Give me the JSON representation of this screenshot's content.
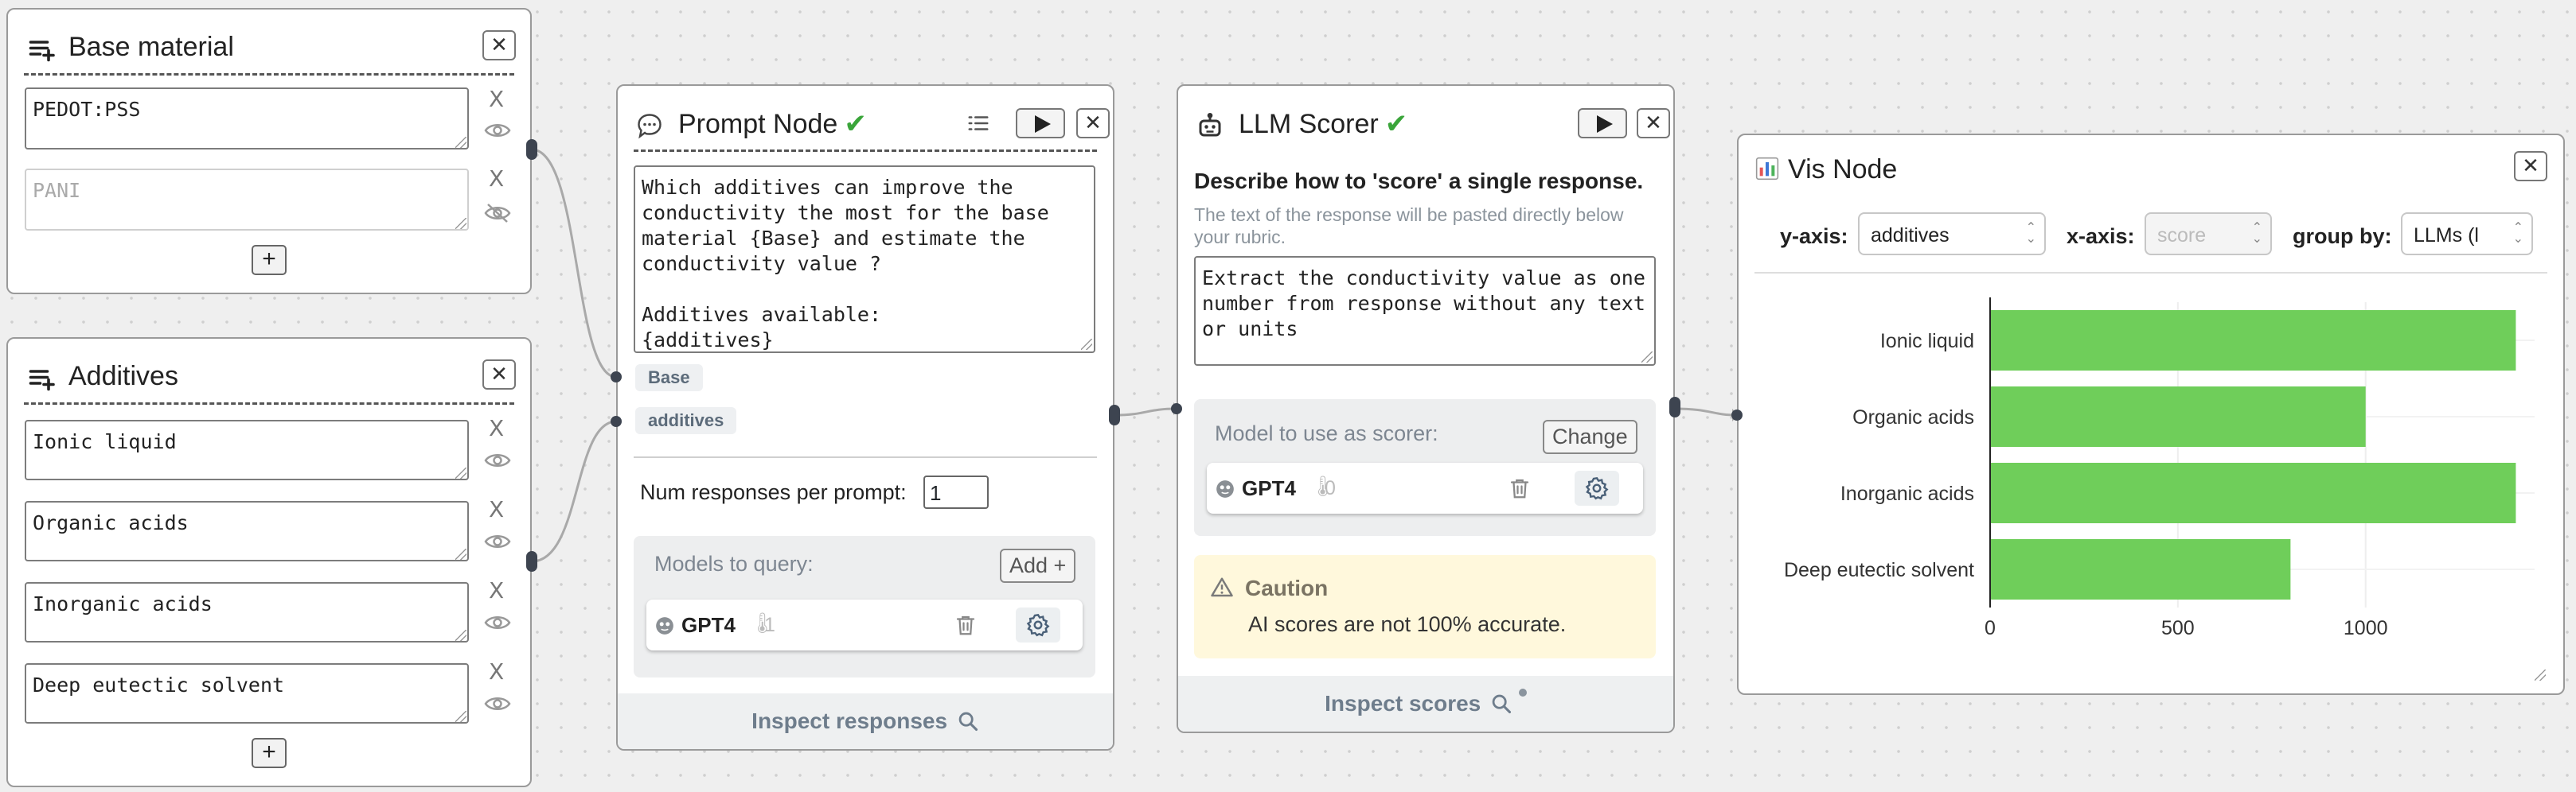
{
  "base_material_node": {
    "title": "Base material",
    "items": [
      {
        "value": "PEDOT:PSS",
        "enabled": true
      },
      {
        "value": "PANI",
        "enabled": false
      }
    ],
    "remove_label": "X",
    "add_label": "+"
  },
  "additives_node": {
    "title": "Additives",
    "items": [
      {
        "value": "Ionic liquid"
      },
      {
        "value": "Organic acids"
      },
      {
        "value": "Inorganic acids"
      },
      {
        "value": "Deep eutectic solvent"
      }
    ],
    "remove_label": "X",
    "add_label": "+"
  },
  "prompt_node": {
    "title": "Prompt Node",
    "prompt_text": "Which additives can improve the conductivity the most for the base material {Base} and estimate the conductivity value ?\n\nAdditives available:\n{additives}",
    "inputs": [
      "Base",
      "additives"
    ],
    "num_responses_label": "Num responses per prompt:",
    "num_responses_value": "1",
    "models_label": "Models to query:",
    "add_model_label": "Add +",
    "model": {
      "name": "GPT4",
      "temperature": "1"
    },
    "footer": "Inspect responses"
  },
  "llm_scorer_node": {
    "title": "LLM Scorer",
    "heading": "Describe how to 'score' a single response.",
    "subtext": "The text of the response will be pasted directly below your rubric.",
    "rubric": "Extract the conductivity value as one number from response without any text or units",
    "scorer_label": "Model to use as scorer:",
    "change_label": "Change",
    "model": {
      "name": "GPT4",
      "temperature": "0"
    },
    "caution_title": "Caution",
    "caution_text": "AI scores are not 100% accurate.",
    "footer": "Inspect scores"
  },
  "vis_node": {
    "title": "Vis Node",
    "y_axis_label": "y-axis:",
    "y_axis_value": "additives",
    "x_axis_label": "x-axis:",
    "x_axis_value": "score",
    "group_by_label": "group by:",
    "group_by_value": "LLMs (l"
  },
  "chart_data": {
    "type": "bar",
    "orientation": "horizontal",
    "categories": [
      "Ionic liquid",
      "Organic acids",
      "Inorganic acids",
      "Deep eutectic solvent"
    ],
    "values": [
      1400,
      1000,
      1400,
      800
    ],
    "xlim": [
      0,
      1400
    ],
    "xticks": [
      "0",
      "500",
      "1000"
    ],
    "bar_color": "#6fce5a",
    "grid": true
  },
  "colors": {
    "accent_green": "#3aa53a",
    "handle": "#3d4450",
    "bar": "#6fce5a"
  }
}
